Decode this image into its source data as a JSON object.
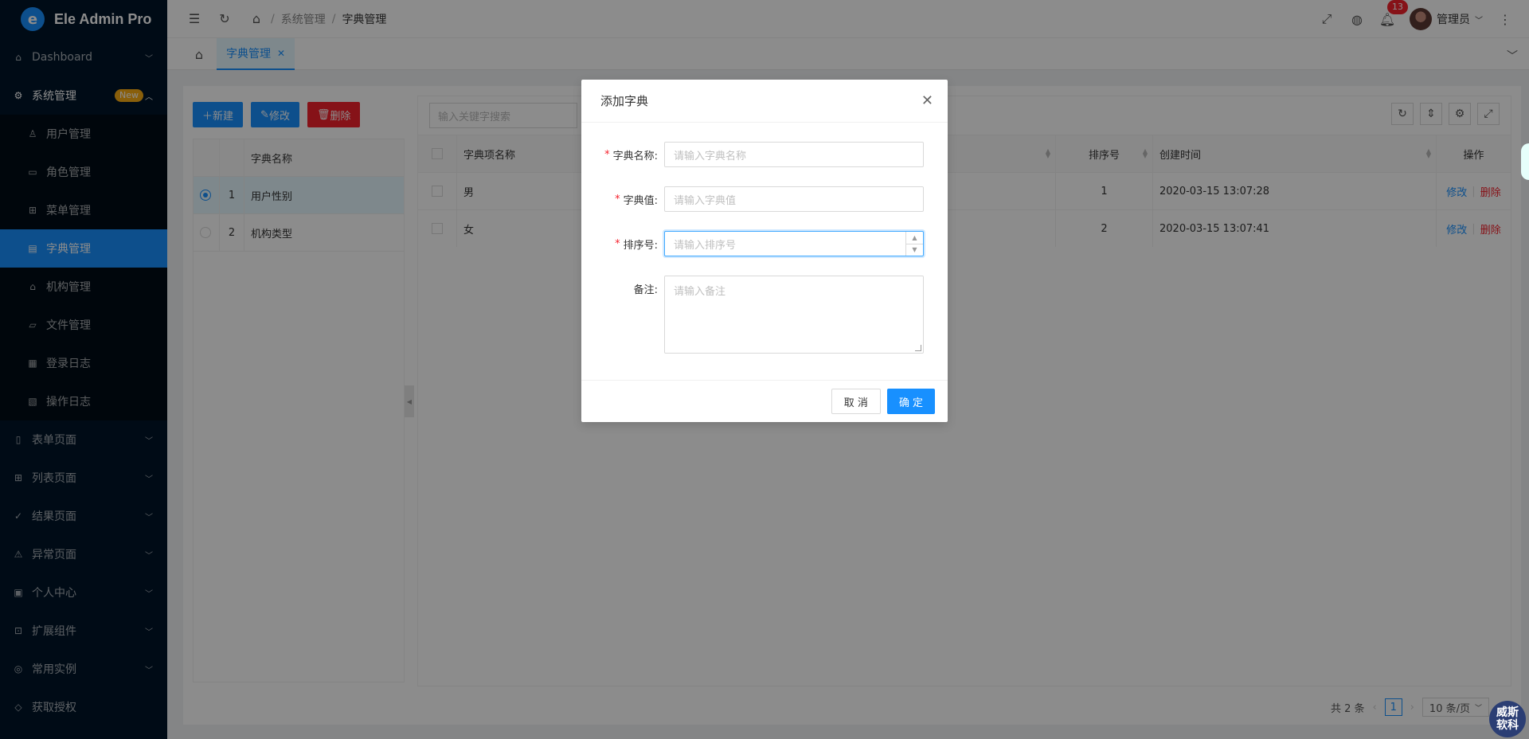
{
  "app": {
    "title": "Ele Admin Pro",
    "logo_letter": "e"
  },
  "sidebar": {
    "items": [
      {
        "label": "Dashboard",
        "icon": "home-icon"
      },
      {
        "label": "系统管理",
        "icon": "gear-icon",
        "badge": "New"
      },
      {
        "label": "表单页面",
        "icon": "file-icon"
      },
      {
        "label": "列表页面",
        "icon": "table-icon"
      },
      {
        "label": "结果页面",
        "icon": "check-circle-icon"
      },
      {
        "label": "异常页面",
        "icon": "warning-icon"
      },
      {
        "label": "个人中心",
        "icon": "user-icon"
      },
      {
        "label": "扩展组件",
        "icon": "appstore-icon"
      },
      {
        "label": "常用实例",
        "icon": "compass-icon"
      },
      {
        "label": "获取授权",
        "icon": "diamond-icon"
      }
    ],
    "sub_items": [
      {
        "label": "用户管理",
        "icon": "user-icon"
      },
      {
        "label": "角色管理",
        "icon": "id-card-icon"
      },
      {
        "label": "菜单管理",
        "icon": "appstore-icon"
      },
      {
        "label": "字典管理",
        "icon": "profile-icon",
        "active": true
      },
      {
        "label": "机构管理",
        "icon": "bank-icon"
      },
      {
        "label": "文件管理",
        "icon": "folder-icon"
      },
      {
        "label": "登录日志",
        "icon": "calendar-icon"
      },
      {
        "label": "操作日志",
        "icon": "file-search-icon"
      }
    ]
  },
  "header": {
    "breadcrumb": [
      "系统管理",
      "字典管理"
    ],
    "notification_count": "13",
    "username": "管理员"
  },
  "tabs": {
    "active_label": "字典管理"
  },
  "left_panel": {
    "buttons": {
      "add": "新建",
      "edit": "修改",
      "delete": "删除"
    },
    "column_name": "字典名称",
    "rows": [
      {
        "index": "1",
        "name": "用户性别",
        "selected": true
      },
      {
        "index": "2",
        "name": "机构类型",
        "selected": false
      }
    ]
  },
  "right_panel": {
    "search_placeholder": "输入关键字搜索",
    "columns": {
      "label": "字典项名称",
      "sort": "排序号",
      "time": "创建时间",
      "ops": "操作"
    },
    "rows": [
      {
        "label": "男",
        "sort": "1",
        "time": "2020-03-15 13:07:28",
        "edit": "修改",
        "delete": "删除"
      },
      {
        "label": "女",
        "sort": "2",
        "time": "2020-03-15 13:07:41",
        "edit": "修改",
        "delete": "删除"
      }
    ],
    "pagination": {
      "total": "共 2 条",
      "current": "1",
      "page_size": "10 条/页"
    }
  },
  "modal": {
    "title": "添加字典",
    "fields": {
      "name": {
        "label": "字典名称:",
        "placeholder": "请输入字典名称"
      },
      "value": {
        "label": "字典值:",
        "placeholder": "请输入字典值"
      },
      "sort": {
        "label": "排序号:",
        "placeholder": "请输入排序号"
      },
      "remark": {
        "label": "备注:",
        "placeholder": "请输入备注"
      }
    },
    "cancel": "取 消",
    "ok": "确 定"
  },
  "watermark": {
    "text": "威斯软科"
  },
  "colors": {
    "primary": "#1890ff",
    "danger": "#f5222d",
    "sidebar_bg": "#001529",
    "badge": "#faad14"
  }
}
